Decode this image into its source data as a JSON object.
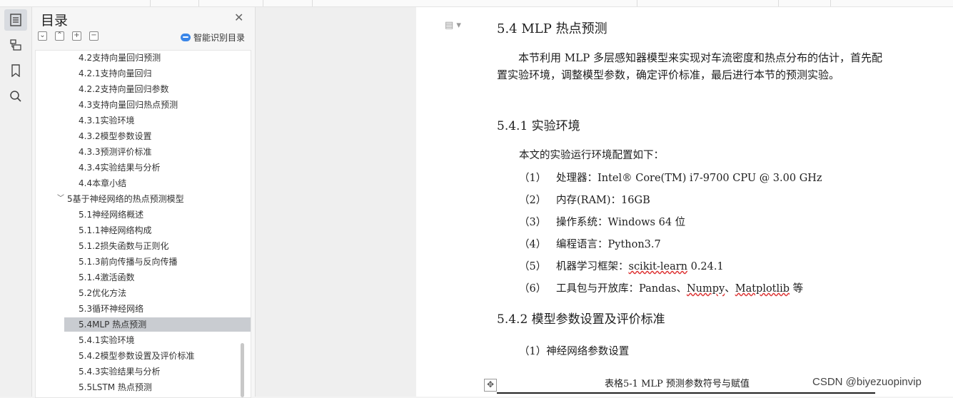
{
  "sidebar": {
    "title": "目录",
    "smart_toc_label": "智能识别目录",
    "tools": [
      "⌄",
      "⌃",
      "+",
      "−"
    ],
    "items": [
      {
        "label": "4.2支持向量回归预测",
        "level": 2
      },
      {
        "label": "4.2.1支持向量回归",
        "level": 2
      },
      {
        "label": "4.2.2支持向量回归参数",
        "level": 2
      },
      {
        "label": "4.3支持向量回归热点预测",
        "level": 2
      },
      {
        "label": "4.3.1实验环境",
        "level": 2
      },
      {
        "label": "4.3.2模型参数设置",
        "level": 2
      },
      {
        "label": "4.3.3预测评价标准",
        "level": 2
      },
      {
        "label": "4.3.4实验结果与分析",
        "level": 2
      },
      {
        "label": "4.4本章小结",
        "level": 2
      },
      {
        "label": "5基于神经网络的热点预测模型",
        "level": 1,
        "expanded": true
      },
      {
        "label": "5.1神经网络概述",
        "level": 2
      },
      {
        "label": "5.1.1神经网络构成",
        "level": 2
      },
      {
        "label": "5.1.2损失函数与正则化",
        "level": 2
      },
      {
        "label": "5.1.3前向传播与反向传播",
        "level": 2
      },
      {
        "label": "5.1.4激活函数",
        "level": 2
      },
      {
        "label": "5.2优化方法",
        "level": 2
      },
      {
        "label": "5.3循环神经网络",
        "level": 2
      },
      {
        "label": "5.4MLP 热点预测",
        "level": 2,
        "selected": true
      },
      {
        "label": "5.4.1实验环境",
        "level": 2
      },
      {
        "label": "5.4.2模型参数设置及评价标准",
        "level": 2
      },
      {
        "label": "5.4.3实验结果与分析",
        "level": 2
      },
      {
        "label": "5.5LSTM 热点预测",
        "level": 2
      }
    ]
  },
  "document": {
    "heading": "5.4 MLP 热点预测",
    "intro": "本节利用 MLP 多层感知器模型来实现对车流密度和热点分布的估计，首先配置实验环境，调整模型参数，确定评价标准，最后进行本节的预测实验。",
    "sub1": "5.4.1 实验环境",
    "env_intro": "本文的实验运行环境配置如下：",
    "env_items": [
      {
        "num": "（1）",
        "text": "处理器：Intel® Core(TM) i7-9700 CPU @ 3.00 GHz"
      },
      {
        "num": "（2）",
        "text": "内存(RAM)：16GB"
      },
      {
        "num": "（3）",
        "text": "操作系统：Windows 64 位"
      },
      {
        "num": "（4）",
        "text": "编程语言：Python3.7"
      },
      {
        "num": "（5）",
        "text_pre": "机器学习框架：",
        "text_sq": "scikit-learn",
        "text_post": " 0.24.1"
      },
      {
        "num": "（6）",
        "text_pre": "工具包与开放库：Pandas、",
        "text_sq": "Numpy",
        "text_mid": "、",
        "text_sq2": "Matplotlib",
        "text_post": " 等"
      }
    ],
    "sub2": "5.4.2 模型参数设置及评价标准",
    "param_line": "（1）神经网络参数设置",
    "table_caption": "表格5-1    MLP 预测参数符号与赋值"
  },
  "watermark": "CSDN @biyezuopinvip"
}
